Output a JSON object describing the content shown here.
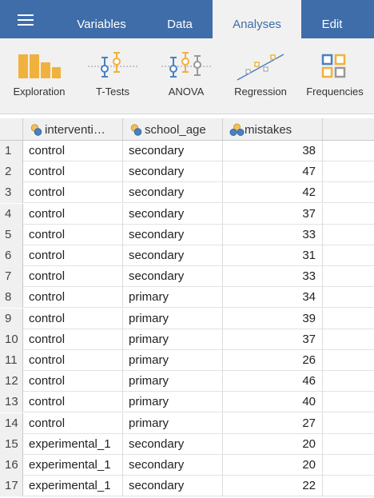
{
  "menu": {
    "tabs": [
      {
        "label": "Variables"
      },
      {
        "label": "Data"
      },
      {
        "label": "Analyses"
      },
      {
        "label": "Edit"
      }
    ],
    "active_tab": "Analyses"
  },
  "ribbon": {
    "items": [
      {
        "label": "Exploration",
        "icon": "exploration-icon"
      },
      {
        "label": "T-Tests",
        "icon": "ttests-icon"
      },
      {
        "label": "ANOVA",
        "icon": "anova-icon"
      },
      {
        "label": "Regression",
        "icon": "regression-icon"
      },
      {
        "label": "Frequencies",
        "icon": "frequencies-icon"
      }
    ]
  },
  "grid": {
    "columns": [
      {
        "label": "interventi…",
        "icon": "nominal-variable-icon"
      },
      {
        "label": "school_age",
        "icon": "nominal-variable-icon"
      },
      {
        "label": "mistakes",
        "icon": "continuous-variable-icon"
      }
    ],
    "rows": [
      {
        "n": "1",
        "intervention": "control",
        "school_age": "secondary",
        "mistakes": "38"
      },
      {
        "n": "2",
        "intervention": "control",
        "school_age": "secondary",
        "mistakes": "47"
      },
      {
        "n": "3",
        "intervention": "control",
        "school_age": "secondary",
        "mistakes": "42"
      },
      {
        "n": "4",
        "intervention": "control",
        "school_age": "secondary",
        "mistakes": "37"
      },
      {
        "n": "5",
        "intervention": "control",
        "school_age": "secondary",
        "mistakes": "33"
      },
      {
        "n": "6",
        "intervention": "control",
        "school_age": "secondary",
        "mistakes": "31"
      },
      {
        "n": "7",
        "intervention": "control",
        "school_age": "secondary",
        "mistakes": "33"
      },
      {
        "n": "8",
        "intervention": "control",
        "school_age": "primary",
        "mistakes": "34"
      },
      {
        "n": "9",
        "intervention": "control",
        "school_age": "primary",
        "mistakes": "39"
      },
      {
        "n": "10",
        "intervention": "control",
        "school_age": "primary",
        "mistakes": "37"
      },
      {
        "n": "11",
        "intervention": "control",
        "school_age": "primary",
        "mistakes": "26"
      },
      {
        "n": "12",
        "intervention": "control",
        "school_age": "primary",
        "mistakes": "46"
      },
      {
        "n": "13",
        "intervention": "control",
        "school_age": "primary",
        "mistakes": "40"
      },
      {
        "n": "14",
        "intervention": "control",
        "school_age": "primary",
        "mistakes": "27"
      },
      {
        "n": "15",
        "intervention": "experimental_1",
        "school_age": "secondary",
        "mistakes": "20"
      },
      {
        "n": "16",
        "intervention": "experimental_1",
        "school_age": "secondary",
        "mistakes": "20"
      },
      {
        "n": "17",
        "intervention": "experimental_1",
        "school_age": "secondary",
        "mistakes": "22"
      }
    ]
  },
  "colors": {
    "menu_bar": "#3e6da9",
    "ribbon_bg": "#f1f1f1",
    "icon_orange": "#f0b23c",
    "icon_blue": "#4a80c4"
  }
}
